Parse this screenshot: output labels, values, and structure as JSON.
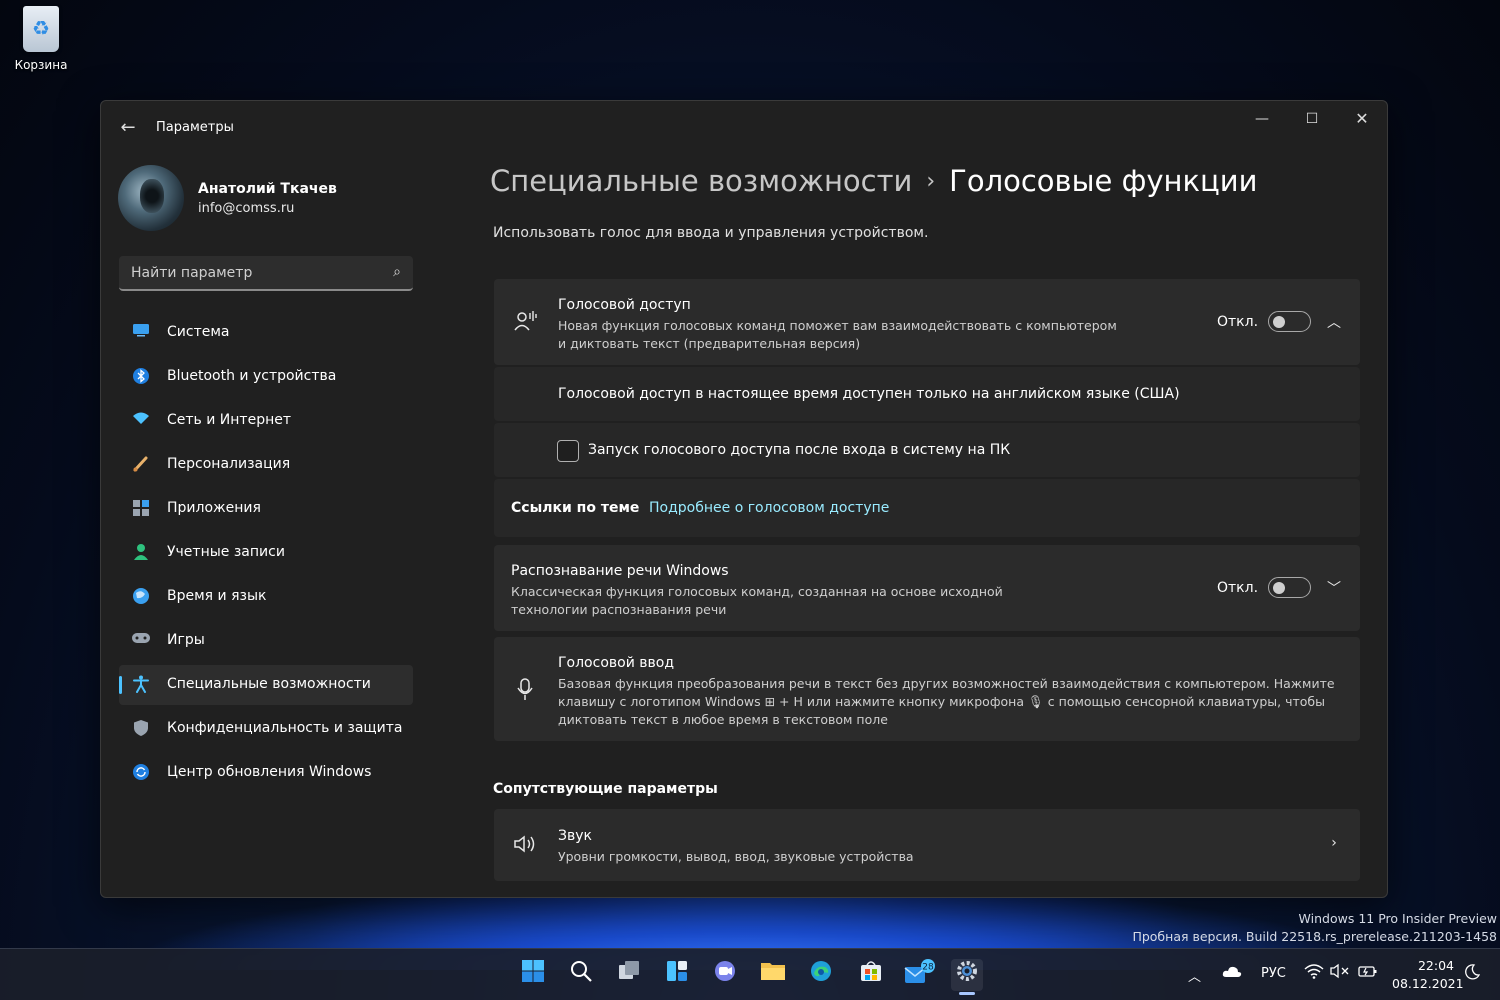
{
  "desktop": {
    "recycle_bin_label": "Корзина"
  },
  "window": {
    "title": "Параметры",
    "controls": {
      "minimize": "—",
      "maximize": "☐",
      "close": "✕"
    }
  },
  "profile": {
    "name": "Анатолий Ткачев",
    "email": "info@comss.ru"
  },
  "search": {
    "placeholder": "Найти параметр"
  },
  "sidebar": {
    "items": [
      {
        "label": "Система",
        "icon": "system-icon"
      },
      {
        "label": "Bluetooth и устройства",
        "icon": "bluetooth-icon"
      },
      {
        "label": "Сеть и Интернет",
        "icon": "wifi-icon"
      },
      {
        "label": "Персонализация",
        "icon": "brush-icon"
      },
      {
        "label": "Приложения",
        "icon": "apps-icon"
      },
      {
        "label": "Учетные записи",
        "icon": "person-icon"
      },
      {
        "label": "Время и язык",
        "icon": "globe-icon"
      },
      {
        "label": "Игры",
        "icon": "gamepad-icon"
      },
      {
        "label": "Специальные возможности",
        "icon": "accessibility-icon",
        "active": true
      },
      {
        "label": "Конфиденциальность и защита",
        "icon": "shield-icon"
      },
      {
        "label": "Центр обновления Windows",
        "icon": "update-icon"
      }
    ]
  },
  "main": {
    "breadcrumb_parent": "Специальные возможности",
    "breadcrumb_sep": "›",
    "breadcrumb_current": "Голосовые функции",
    "subtitle": "Использовать голос для ввода и управления устройством.",
    "voice_access": {
      "title": "Голосовой доступ",
      "desc": "Новая функция голосовых команд поможет вам взаимодействовать с компьютером и диктовать текст (предварительная версия)",
      "toggle_label": "Откл.",
      "toggle_on": false,
      "note": "Голосовой доступ в настоящее время доступен только на английском языке (США)",
      "checkbox_label": "Запуск голосового доступа после входа в систему на ПК",
      "checkbox_checked": false,
      "links_label": "Ссылки по теме",
      "link": "Подробнее о голосовом доступе"
    },
    "speech_recognition": {
      "title": "Распознавание речи Windows",
      "desc": "Классическая функция голосовых команд, созданная на основе исходной технологии распознавания речи",
      "toggle_label": "Откл.",
      "toggle_on": false
    },
    "voice_typing": {
      "title": "Голосовой ввод",
      "desc": "Базовая функция преобразования речи в текст без других возможностей взаимодействия с компьютером. Нажмите клавишу с логотипом Windows ⊞ + H или нажмите кнопку микрофона 🎙 с помощью сенсорной клавиатуры, чтобы диктовать текст в любое время в текстовом поле"
    },
    "related_title": "Сопутствующие параметры",
    "sound": {
      "title": "Звук",
      "desc": "Уровни громкости, вывод, ввод, звуковые устройства"
    }
  },
  "watermark": {
    "line1": "Windows 11 Pro Insider Preview",
    "line2": "Пробная версия. Build 22518.rs_prerelease.211203-1458"
  },
  "taskbar": {
    "badge_count": "28",
    "language": "РУС",
    "time": "22:04",
    "date": "08.12.2021"
  },
  "colors": {
    "accent": "#4cc2ff",
    "link": "#99ebff",
    "window_bg": "#202020",
    "card_bg": "#2b2b2b"
  }
}
